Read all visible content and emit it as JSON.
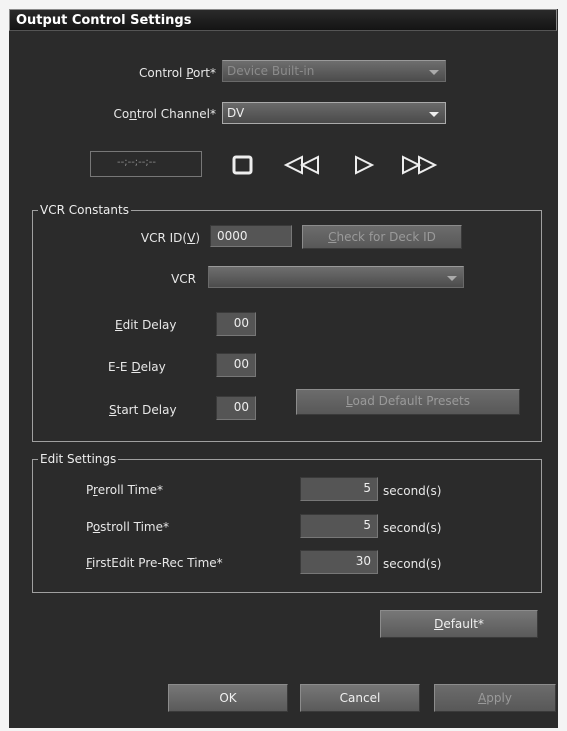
{
  "window": {
    "title": "Output Control Settings"
  },
  "control": {
    "port_label": "Control Port*",
    "port_value": "Device Built-in",
    "channel_label": "Control Channel*",
    "channel_value": "DV",
    "timecode": "--;--;--;--"
  },
  "transport": {
    "icons": [
      "stop-icon",
      "rewind-icon",
      "play-icon",
      "fast-forward-icon"
    ]
  },
  "vcr": {
    "group_label": "VCR Constants",
    "vcr_id_label": "VCR ID(V)",
    "vcr_id_value": "0000",
    "check_deck_button": "Check for Deck ID",
    "vcr_label": "VCR",
    "vcr_value": "",
    "edit_delay_label": "Edit Delay",
    "edit_delay_value": "00",
    "ee_delay_label": "E-E Delay",
    "ee_delay_value": "00",
    "start_delay_label": "Start Delay",
    "start_delay_value": "00",
    "load_presets_button": "Load Default Presets"
  },
  "edit": {
    "group_label": "Edit Settings",
    "rows": [
      {
        "label": "Preroll Time*",
        "value": "5",
        "unit": "second(s)"
      },
      {
        "label": "Postroll Time*",
        "value": "5",
        "unit": "second(s)"
      },
      {
        "label": "FirstEdit Pre-Rec Time*",
        "value": "30",
        "unit": "second(s)"
      }
    ]
  },
  "buttons": {
    "default": "Default*",
    "ok": "OK",
    "cancel": "Cancel",
    "apply": "Apply"
  }
}
